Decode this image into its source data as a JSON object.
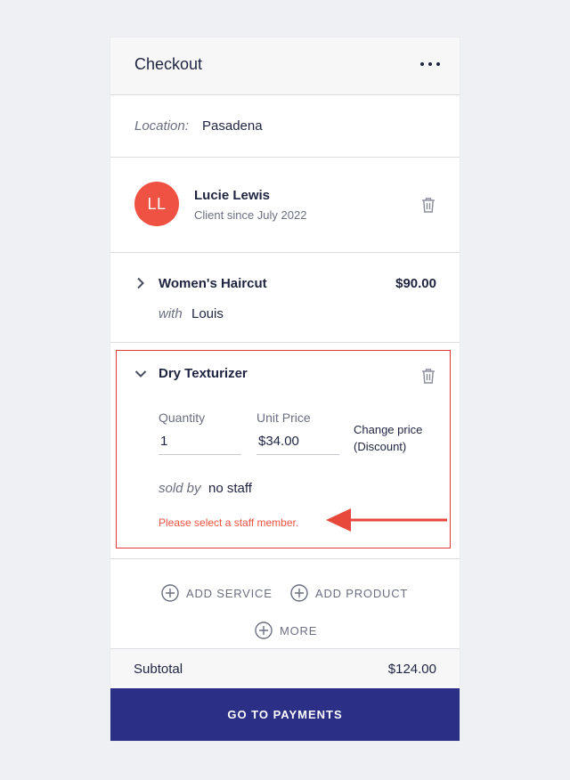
{
  "header": {
    "title": "Checkout",
    "more_icon": "more-horizontal-icon"
  },
  "location": {
    "label": "Location:",
    "value": "Pasadena"
  },
  "client": {
    "initials": "LL",
    "name": "Lucie Lewis",
    "since": "Client since July 2022",
    "avatar_color": "#ef5142",
    "delete_icon": "trash-icon"
  },
  "service": {
    "name": "Women's Haircut",
    "price": "$90.00",
    "with_label": "with",
    "with_value": "Louis",
    "expand_icon": "chevron-right-icon"
  },
  "product": {
    "name": "Dry Texturizer",
    "collapse_icon": "chevron-down-icon",
    "delete_icon": "trash-icon",
    "quantity_label": "Quantity",
    "quantity_value": "1",
    "unit_price_label": "Unit Price",
    "unit_price_value": "$34.00",
    "change_price": "Change price (Discount)",
    "sold_by_label": "sold by",
    "sold_by_value": "no staff",
    "error": "Please select a staff member.",
    "error_color": "#ef5142",
    "highlight_color": "#e2383a"
  },
  "actions": {
    "add_service": "ADD SERVICE",
    "add_product": "ADD PRODUCT",
    "more": "MORE",
    "icon": "plus-circle-icon"
  },
  "subtotal": {
    "label": "Subtotal",
    "value": "$124.00"
  },
  "payments": {
    "label": "GO TO PAYMENTS",
    "color": "#2b2f86"
  }
}
